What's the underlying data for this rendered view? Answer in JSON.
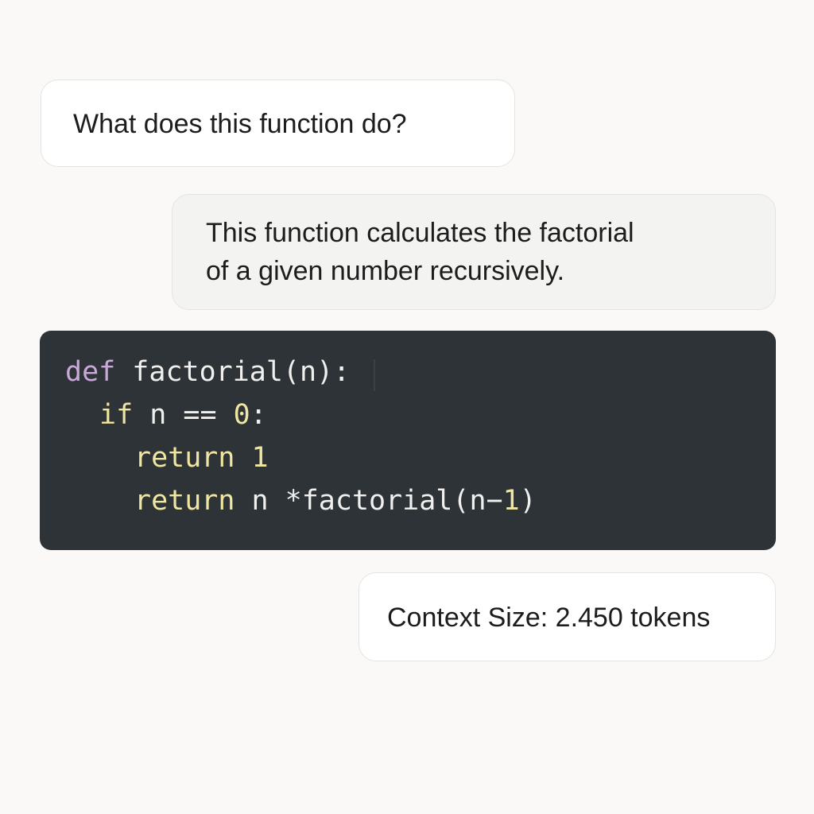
{
  "conversation": {
    "user_message": "What does this function do?",
    "assistant_message": {
      "line1": "This function calculates the factorial",
      "line2": "of a given number recursively."
    },
    "code": {
      "line1": {
        "keyword": "def",
        "rest": "factorial(n):"
      },
      "line2": {
        "keyword": "if",
        "text": "n == ",
        "number": "0",
        "tail": ":"
      },
      "line3": {
        "keyword": "return",
        "number": "1"
      },
      "line4": {
        "keyword": "return",
        "text": "n *factorial(n−",
        "number": "1",
        "tail": ")"
      }
    },
    "context_size": "Context Size: 2.450 tokens"
  },
  "colors": {
    "background": "#faf9f7",
    "code_background": "#2e3338",
    "keyword_def": "#c9a9d8",
    "keyword_flow": "#efe6a2",
    "code_text": "#f0f0ee"
  }
}
